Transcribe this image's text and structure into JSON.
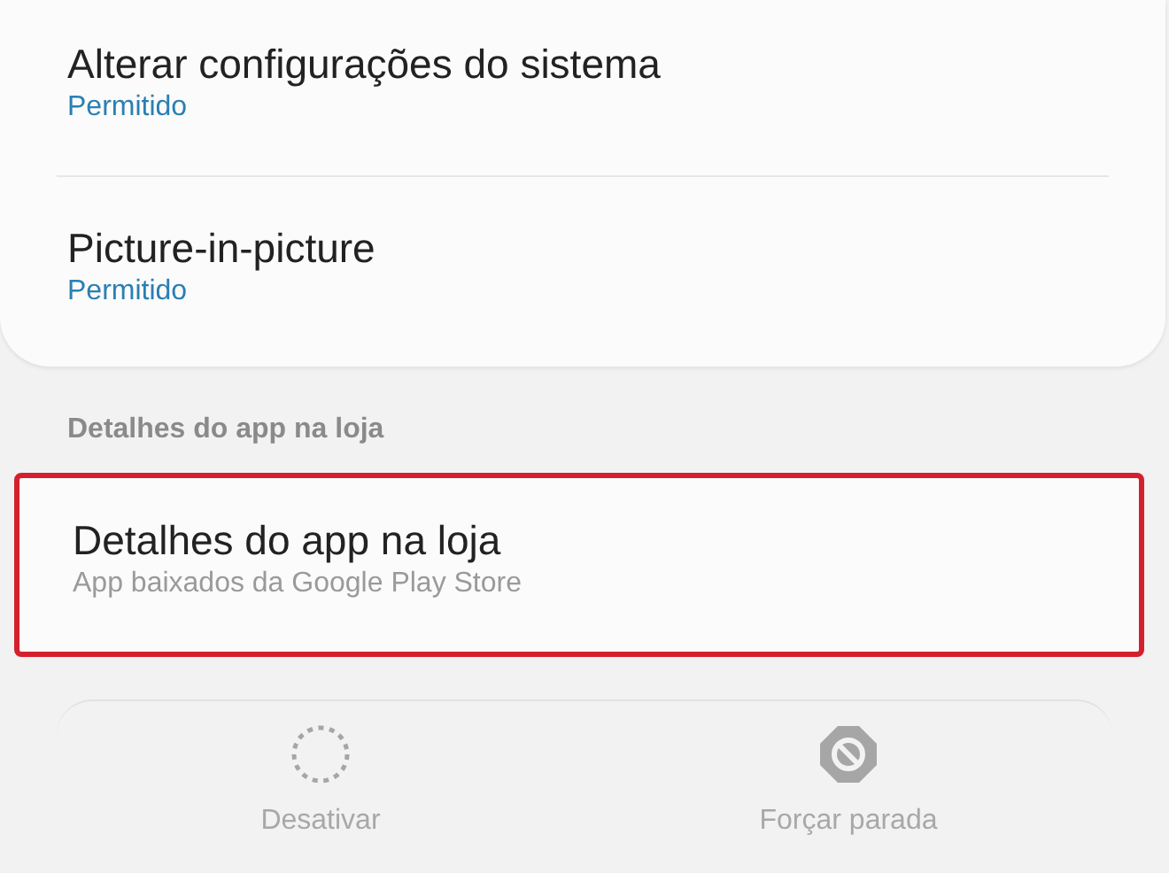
{
  "permissions": [
    {
      "title": "Alterar configurações do sistema",
      "status": "Permitido"
    },
    {
      "title": "Picture-in-picture",
      "status": "Permitido"
    }
  ],
  "store_section": {
    "header": "Detalhes do app na loja",
    "item": {
      "title": "Detalhes do app na loja",
      "subtitle": "App baixados da Google Play Store",
      "highlighted": true
    }
  },
  "actions": [
    {
      "kind": "disable",
      "label": "Desativar",
      "disabled": true
    },
    {
      "kind": "force-stop",
      "label": "Forçar parada",
      "disabled": true
    }
  ]
}
